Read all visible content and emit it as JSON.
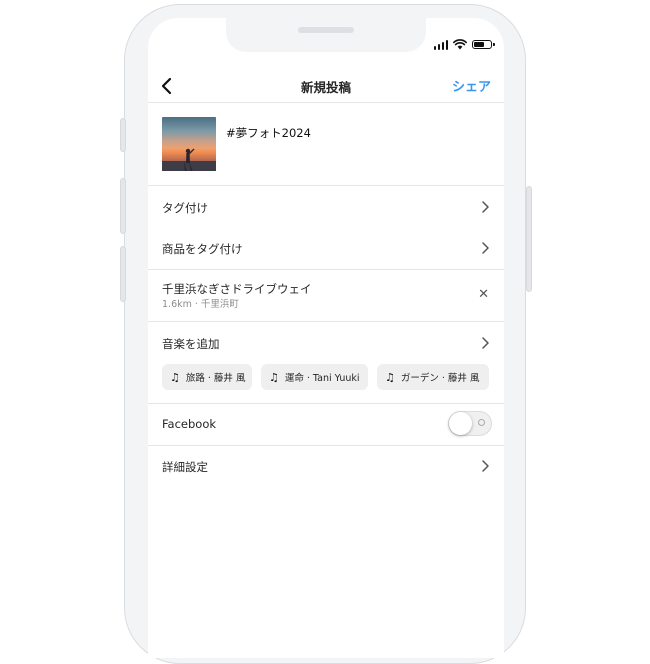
{
  "status": {
    "icons": [
      "signal-icon",
      "wifi-icon",
      "battery-icon"
    ]
  },
  "nav": {
    "back_icon": "chevron-left-icon",
    "title": "新規投稿",
    "share_label": "シェア"
  },
  "post": {
    "caption": "#夢フォト2024"
  },
  "rows": {
    "tag_people": "タグ付け",
    "tag_products": "商品をタグ付け",
    "location": {
      "name": "千里浜なぎさドライブウェイ",
      "detail": "1.6km · 千里浜町"
    },
    "add_music": "音楽を追加",
    "music_chips": [
      "旅路 · 藤井 風",
      "運命 · Tani Yuuki",
      "ガーデン · 藤井 風"
    ],
    "facebook": {
      "label": "Facebook",
      "enabled": false
    },
    "advanced": "詳細設定"
  },
  "colors": {
    "accent": "#3897f0",
    "divider": "#e6e6e6",
    "chip_bg": "#efefef"
  }
}
